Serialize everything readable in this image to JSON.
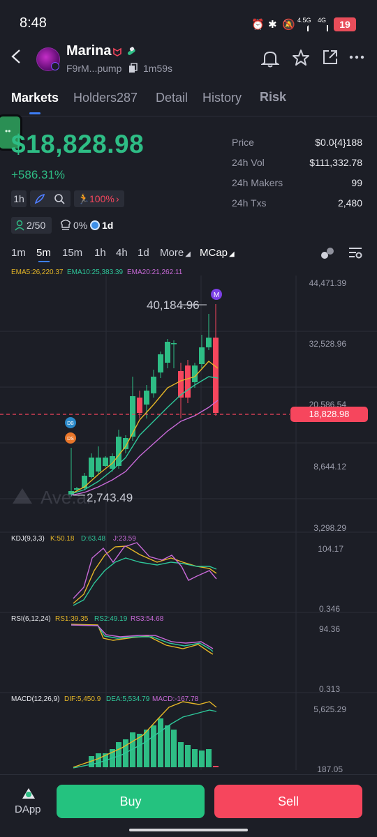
{
  "status_bar": {
    "time": "8:48",
    "net1": "4.5G",
    "net2": "4G",
    "battery": "19"
  },
  "header": {
    "name": "Marina",
    "address": "F9rM...pump",
    "age": "1m59s"
  },
  "icons": {
    "back": "back-arrow-icon",
    "bell": "bell-icon",
    "star": "star-icon",
    "share": "share-icon",
    "more": "more-icon"
  },
  "tabs": [
    {
      "label": "Markets"
    },
    {
      "label": "Holders287"
    },
    {
      "label": "Detail"
    },
    {
      "label": "History"
    },
    {
      "label": "Risk"
    }
  ],
  "summary": {
    "mcap": "$18,828.98",
    "change": "+586.31%"
  },
  "stats": [
    {
      "label": "Price",
      "value": "$0.0{4}188"
    },
    {
      "label": "24h Vol",
      "value": "$111,332.78"
    },
    {
      "label": "24h Makers",
      "value": "99"
    },
    {
      "label": "24h Txs",
      "value": "2,480"
    }
  ],
  "chips": {
    "interval": "1h",
    "runner": "100%",
    "holders": "2/50",
    "chef": "0%",
    "period": "1d"
  },
  "intervals": [
    {
      "label": "1m"
    },
    {
      "label": "5m"
    },
    {
      "label": "15m"
    },
    {
      "label": "1h"
    },
    {
      "label": "4h"
    },
    {
      "label": "1d"
    },
    {
      "label": "More"
    }
  ],
  "mcap_toggle": "MCap",
  "indicators": {
    "ema": [
      {
        "label": "EMA5:26,220.37"
      },
      {
        "label": "EMA10:25,383.39"
      },
      {
        "label": "EMA20:21,262.11"
      }
    ],
    "kdj": {
      "title": "KDJ(9,3,3)",
      "k": "K:50.18",
      "d": "D:63.48",
      "j": "J:23.59"
    },
    "rsi": {
      "title": "RSI(6,12,24)",
      "r1": "RS1:39.35",
      "r2": "RS2:49.19",
      "r3": "RS3:54.68"
    },
    "macd": {
      "title": "MACD(12,26,9)",
      "dif": "DIF:5,450.9",
      "dea": "DEA:5,534.79",
      "macd": "MACD:-167.78"
    }
  },
  "chart_data": {
    "type": "candlestick",
    "y_axis": [
      "44,471.39",
      "32,528.96",
      "20,586.54",
      "8,644.12",
      "3,298.29"
    ],
    "high_label": "40,184.96",
    "low_label": "2,743.49",
    "current_label": "18,828.98",
    "kdj_axis": [
      "104.17",
      "0.346"
    ],
    "rsi_axis": [
      "94.36",
      "0.313"
    ],
    "macd_axis": [
      "5,625.29",
      "187.05"
    ],
    "markers": [
      "M",
      "DB",
      "DS"
    ],
    "watermark": "Ave.ai",
    "colors": {
      "up": "#2ebd85",
      "down": "#f6465d",
      "ema5": "#e5b627",
      "ema10": "#2ec79a",
      "ema20": "#c86ad8"
    }
  },
  "bottom": {
    "dapp": "DApp",
    "buy": "Buy",
    "sell": "Sell"
  }
}
